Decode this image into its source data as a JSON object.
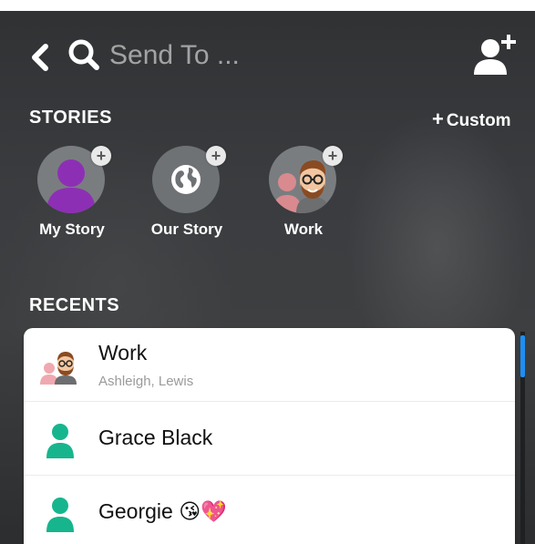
{
  "header": {
    "search_placeholder": "Send To ..."
  },
  "stories": {
    "title": "STORIES",
    "custom_label": "Custom",
    "items": [
      {
        "label": "My Story"
      },
      {
        "label": "Our Story"
      },
      {
        "label": "Work"
      }
    ]
  },
  "recents": {
    "title": "RECENTS",
    "items": [
      {
        "name": "Work",
        "subtitle": "Ashleigh, Lewis"
      },
      {
        "name": "Grace Black"
      },
      {
        "name": "Georgie 😘💖"
      }
    ]
  },
  "icons": {
    "back": "chevron-left-icon",
    "search": "search-icon",
    "add_friend": "add-friend-icon",
    "world": "globe-icon"
  },
  "colors": {
    "accent_purple": "#8d2fb5",
    "accent_teal": "#17b58e",
    "scroll_blue": "#1d8ff5"
  }
}
